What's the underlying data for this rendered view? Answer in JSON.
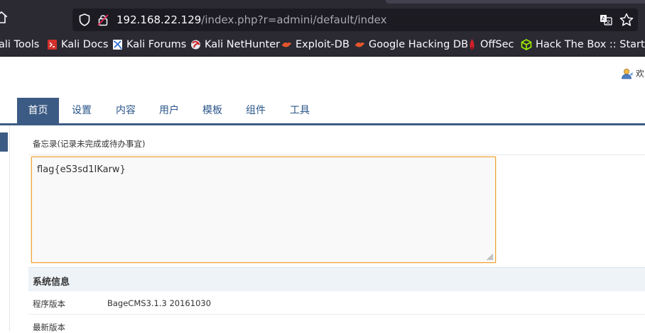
{
  "browser": {
    "url_host": "192.168.22.129",
    "url_path": "/index.php?r=admini/default/index",
    "icons": [
      "home-icon",
      "shield-icon",
      "lock-icon",
      "translate-icon",
      "star-icon"
    ]
  },
  "bookmarks": [
    {
      "label": "ali Tools",
      "icon": "none"
    },
    {
      "label": "Kali Docs",
      "icon": "kali-docs-icon"
    },
    {
      "label": "Kali Forums",
      "icon": "kali-forums-icon"
    },
    {
      "label": "Kali NetHunter",
      "icon": "nethunter-icon"
    },
    {
      "label": "Exploit-DB",
      "icon": "exploit-db-icon"
    },
    {
      "label": "Google Hacking DB",
      "icon": "ghdb-icon"
    },
    {
      "label": "OffSec",
      "icon": "offsec-icon"
    },
    {
      "label": "Hack The Box :: Startin...",
      "icon": "htb-icon"
    }
  ],
  "header": {
    "welcome": "欢"
  },
  "nav": {
    "tabs": [
      "首页",
      "设置",
      "内容",
      "用户",
      "模板",
      "组件",
      "工具"
    ],
    "active_index": 0
  },
  "memo": {
    "label": "备忘录(记录未完成或待办事宜)",
    "value": "flag{eS3sd1IKarw}"
  },
  "system_info": {
    "title": "系统信息",
    "rows": [
      {
        "label": "程序版本",
        "value": "BageCMS3.1.3 20161030"
      },
      {
        "label": "最新版本",
        "value": ""
      }
    ]
  },
  "colors": {
    "chrome_bg": "#2b2a33",
    "urlbar_bg": "#1c1b22",
    "nav_accent": "#3c5b84",
    "nav_text": "#2a5588",
    "memo_border": "#f0a233",
    "sys_header_bg": "#eef3f8"
  }
}
